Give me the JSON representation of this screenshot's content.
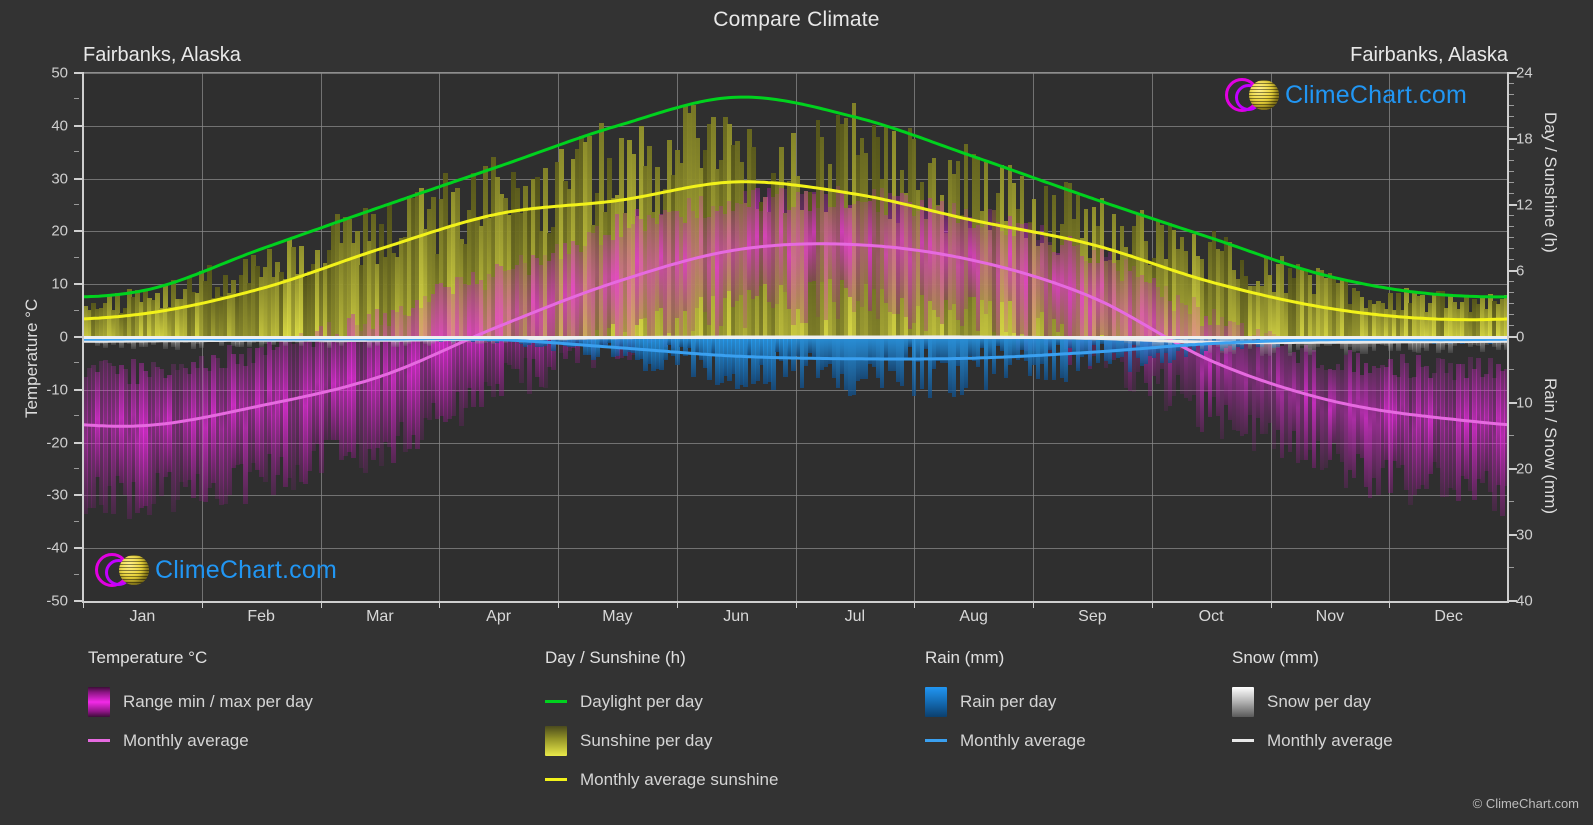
{
  "header": {
    "main_title": "Compare Climate",
    "left_location": "Fairbanks, Alaska",
    "right_location": "Fairbanks, Alaska"
  },
  "branding": {
    "logo_text": "ClimeChart.com",
    "copyright": "© ClimeChart.com",
    "ring_color": "#e000e0",
    "ball_color": "#e8d23a",
    "text_color": "#2196f3"
  },
  "axes": {
    "left_title": "Temperature °C",
    "right_title_top": "Day / Sunshine (h)",
    "right_title_bottom": "Rain / Snow (mm)",
    "temp_ticks": [
      50,
      40,
      30,
      20,
      10,
      0,
      -10,
      -20,
      -30,
      -40,
      -50
    ],
    "day_ticks": [
      24,
      18,
      12,
      6,
      0
    ],
    "precip_ticks": [
      0,
      10,
      20,
      30,
      40
    ],
    "months": [
      "Jan",
      "Feb",
      "Mar",
      "Apr",
      "May",
      "Jun",
      "Jul",
      "Aug",
      "Sep",
      "Oct",
      "Nov",
      "Dec"
    ]
  },
  "legend": {
    "temperature": {
      "heading": "Temperature °C",
      "items": [
        {
          "label": "Range min / max per day",
          "marker": "gradient-swatch",
          "color": "#f22ae8"
        },
        {
          "label": "Monthly average",
          "marker": "line",
          "color": "#e66ae0"
        }
      ]
    },
    "day_sunshine": {
      "heading": "Day / Sunshine (h)",
      "items": [
        {
          "label": "Daylight per day",
          "marker": "line",
          "color": "#00d21e"
        },
        {
          "label": "Sunshine per day",
          "marker": "gradient-swatch",
          "color": "#e9e94a"
        },
        {
          "label": "Monthly average sunshine",
          "marker": "line",
          "color": "#f2f21a"
        }
      ]
    },
    "rain": {
      "heading": "Rain (mm)",
      "items": [
        {
          "label": "Rain per day",
          "marker": "gradient-swatch",
          "color": "#2196f3"
        },
        {
          "label": "Monthly average",
          "marker": "line",
          "color": "#3aa0f0"
        }
      ]
    },
    "snow": {
      "heading": "Snow (mm)",
      "items": [
        {
          "label": "Snow per day",
          "marker": "gradient-swatch",
          "color": "#ffffff"
        },
        {
          "label": "Monthly average",
          "marker": "line",
          "color": "#e8e8e8"
        }
      ]
    }
  },
  "chart_data": {
    "type": "line",
    "title": "Compare Climate",
    "subtitle": "Fairbanks, Alaska",
    "xlabel": "",
    "ylabel": "Temperature °C",
    "grid": true,
    "legend_position": "bottom",
    "x": [
      "Jan",
      "Feb",
      "Mar",
      "Apr",
      "May",
      "Jun",
      "Jul",
      "Aug",
      "Sep",
      "Oct",
      "Nov",
      "Dec"
    ],
    "axis_ranges": {
      "temperature_c": [
        -50,
        50
      ],
      "day_sunshine_h": [
        0,
        24
      ],
      "rain_snow_mm": [
        0,
        40
      ]
    },
    "series": [
      {
        "name": "Monthly average temperature (°C)",
        "unit": "°C",
        "axis": "temperature_c",
        "color": "#e66ae0",
        "values": [
          -16.8,
          -13.0,
          -7.5,
          2.0,
          10.5,
          16.5,
          17.5,
          14.5,
          7.5,
          -4.5,
          -12.0,
          -15.5
        ]
      },
      {
        "name": "Daylight per day (h)",
        "unit": "h",
        "axis": "day_sunshine_h",
        "color": "#00d21e",
        "values": [
          4.2,
          8.0,
          11.8,
          15.5,
          19.2,
          21.8,
          20.0,
          16.4,
          12.6,
          9.0,
          5.5,
          3.8
        ]
      },
      {
        "name": "Monthly average sunshine (h)",
        "unit": "h",
        "axis": "day_sunshine_h",
        "color": "#f2f21a",
        "values": [
          2.1,
          4.4,
          8.0,
          11.2,
          12.4,
          14.1,
          13.0,
          10.6,
          8.4,
          5.0,
          2.6,
          1.6
        ]
      },
      {
        "name": "Monthly average rain (mm)",
        "unit": "mm",
        "axis": "rain_snow_mm",
        "color": "#3aa0f0",
        "values": [
          0.3,
          0.3,
          0.3,
          0.4,
          1.6,
          2.9,
          3.3,
          3.2,
          2.3,
          1.0,
          0.4,
          0.4
        ]
      },
      {
        "name": "Monthly average snow (mm)",
        "unit": "mm",
        "axis": "rain_snow_mm",
        "color": "#e8e8e8",
        "values": [
          0.6,
          0.5,
          0.5,
          0.3,
          0.1,
          0.0,
          0.0,
          0.0,
          0.2,
          0.8,
          0.8,
          0.7
        ]
      }
    ],
    "bands": [
      {
        "name": "Daily temperature range min / max",
        "axis": "temperature_c",
        "color": "#f22ae8",
        "min": [
          -25.5,
          -22.0,
          -16.0,
          -5.0,
          3.0,
          9.5,
          11.0,
          8.5,
          1.5,
          -10.5,
          -20.0,
          -24.0
        ],
        "max": [
          -9.0,
          -5.0,
          1.5,
          9.5,
          18.5,
          23.0,
          23.5,
          20.5,
          13.0,
          1.0,
          -6.5,
          -8.5
        ]
      },
      {
        "name": "Sunshine per day range",
        "axis": "day_sunshine_h",
        "color": "#c9c93a",
        "min": [
          0.0,
          0.0,
          0.0,
          0.0,
          0.0,
          0.0,
          0.0,
          0.0,
          0.0,
          0.0,
          0.0,
          0.0
        ],
        "max": [
          4.2,
          8.0,
          11.8,
          15.5,
          18.8,
          20.5,
          19.5,
          16.0,
          12.4,
          8.8,
          5.4,
          3.8
        ]
      }
    ]
  }
}
